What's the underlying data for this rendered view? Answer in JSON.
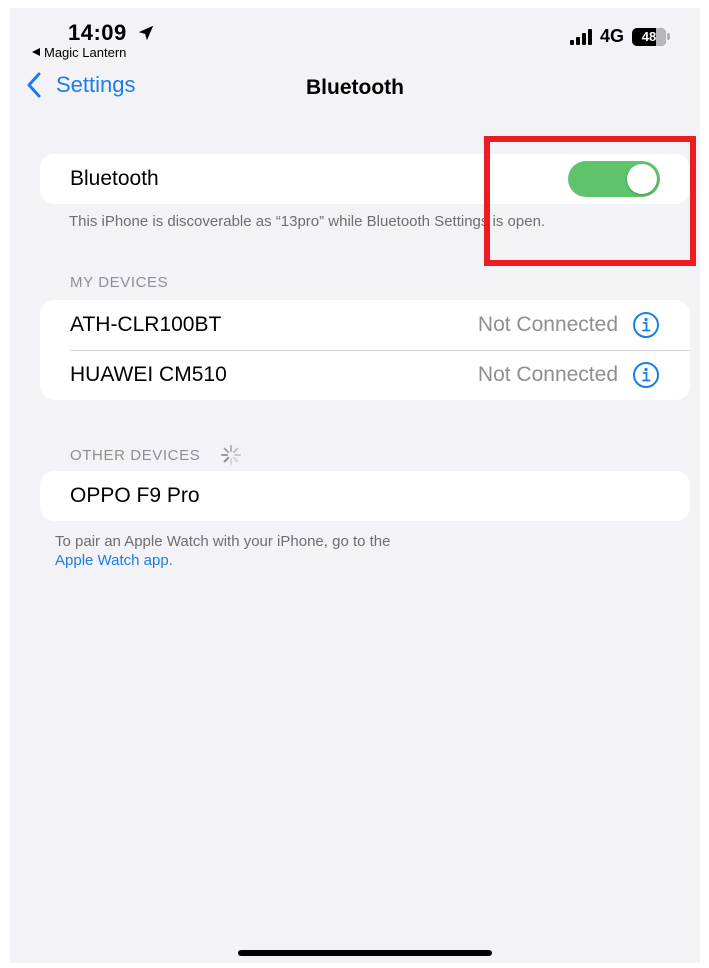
{
  "status_bar": {
    "time": "14:09",
    "back_app": "Magic Lantern",
    "network": "4G",
    "battery": "48"
  },
  "nav": {
    "back_label": "Settings",
    "title": "Bluetooth"
  },
  "bluetooth": {
    "label": "Bluetooth",
    "enabled": true,
    "discoverable_note": "This iPhone is discoverable as “13pro” while Bluetooth Settings is open."
  },
  "my_devices": {
    "header": "MY DEVICES",
    "items": [
      {
        "name": "ATH-CLR100BT",
        "status": "Not Connected"
      },
      {
        "name": "HUAWEI CM510",
        "status": "Not Connected"
      }
    ]
  },
  "other_devices": {
    "header": "OTHER DEVICES",
    "items": [
      {
        "name": "OPPO F9 Pro"
      }
    ]
  },
  "watch_note": {
    "text": "To pair an Apple Watch with your iPhone, go to the",
    "link": "Apple Watch app",
    "suffix": "."
  },
  "colors": {
    "accent": "#1a7ee6",
    "toggle_on": "#5ec36a",
    "highlight": "#ec1c24"
  }
}
